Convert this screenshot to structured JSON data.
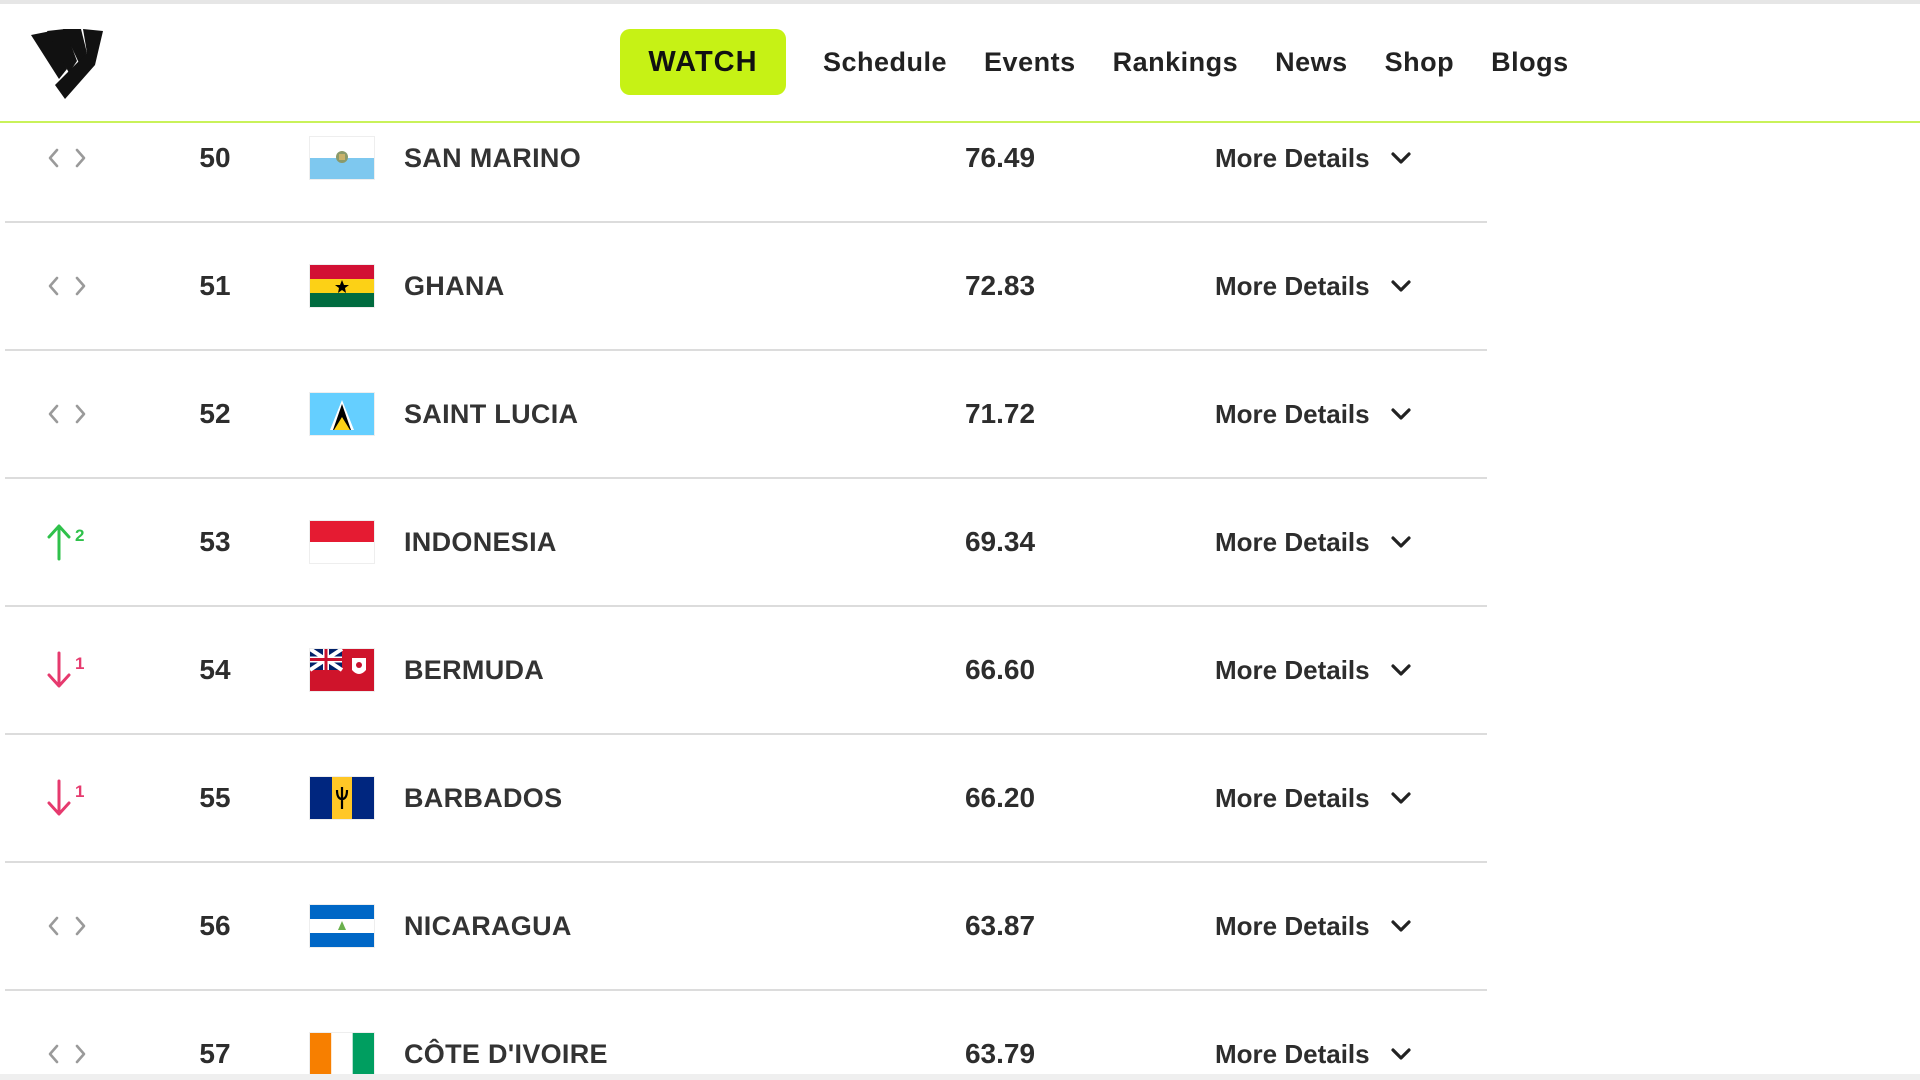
{
  "header": {
    "watch_label": "WATCH",
    "nav": [
      "Schedule",
      "Events",
      "Rankings",
      "News",
      "Shop",
      "Blogs"
    ],
    "accent_color": "#c6f215"
  },
  "rankings": [
    {
      "change": "none",
      "change_value": "",
      "rank": "50",
      "name": "SAN MARINO",
      "flag": "san-marino-flag",
      "points": "76.49",
      "more": "More Details"
    },
    {
      "change": "none",
      "change_value": "",
      "rank": "51",
      "name": "GHANA",
      "flag": "ghana-flag",
      "points": "72.83",
      "more": "More Details"
    },
    {
      "change": "none",
      "change_value": "",
      "rank": "52",
      "name": "SAINT LUCIA",
      "flag": "saint-lucia-flag",
      "points": "71.72",
      "more": "More Details"
    },
    {
      "change": "up",
      "change_value": "2",
      "rank": "53",
      "name": "INDONESIA",
      "flag": "indonesia-flag",
      "points": "69.34",
      "more": "More Details"
    },
    {
      "change": "down",
      "change_value": "1",
      "rank": "54",
      "name": "BERMUDA",
      "flag": "bermuda-flag",
      "points": "66.60",
      "more": "More Details"
    },
    {
      "change": "down",
      "change_value": "1",
      "rank": "55",
      "name": "BARBADOS",
      "flag": "barbados-flag",
      "points": "66.20",
      "more": "More Details"
    },
    {
      "change": "none",
      "change_value": "",
      "rank": "56",
      "name": "NICARAGUA",
      "flag": "nicaragua-flag",
      "points": "63.87",
      "more": "More Details"
    },
    {
      "change": "none",
      "change_value": "",
      "rank": "57",
      "name": "CÔTE D'IVOIRE",
      "flag": "cote-divoire-flag",
      "points": "63.79",
      "more": "More Details"
    }
  ],
  "colors": {
    "up": "#2fc14b",
    "down": "#e63a6e",
    "neutral": "#9a9a9a"
  }
}
